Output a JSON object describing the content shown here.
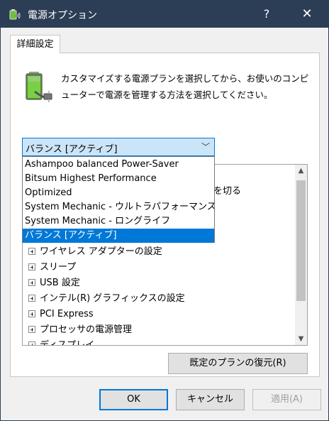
{
  "window": {
    "title": "電源オプション",
    "help_label": "?",
    "close_label": "✕"
  },
  "tab": {
    "label": "詳細設定"
  },
  "description": "カスタマイズする電源プランを選択してから、お使いのコンピューターで電源を管理する方法を選択してください。",
  "plan_select": {
    "selected": "バランス [アクティブ]",
    "options": [
      "Ashampoo balanced Power-Saver",
      "Bitsum Highest Performance",
      "Optimized",
      "System Mechanic - ウルトラパフォーマンス",
      "System Mechanic - ロングライフ",
      "バランス [アクティブ]"
    ]
  },
  "settings_tree": {
    "partial_text": "源を切る",
    "items": [
      "ワイヤレス アダプターの設定",
      "スリープ",
      "USB 設定",
      "インテル(R) グラフィックスの設定",
      "PCI Express",
      "プロセッサの電源管理",
      "ディスプレイ"
    ]
  },
  "buttons": {
    "restore": "既定のプランの復元(R)",
    "ok": "OK",
    "cancel": "キャンセル",
    "apply": "適用(A)"
  },
  "colors": {
    "titlebar": "#2b3e55",
    "accent": "#0078d7",
    "combo_bg": "#cce4f7"
  },
  "icons": {
    "app": "power-options-icon",
    "battery": "battery-plug-icon"
  }
}
